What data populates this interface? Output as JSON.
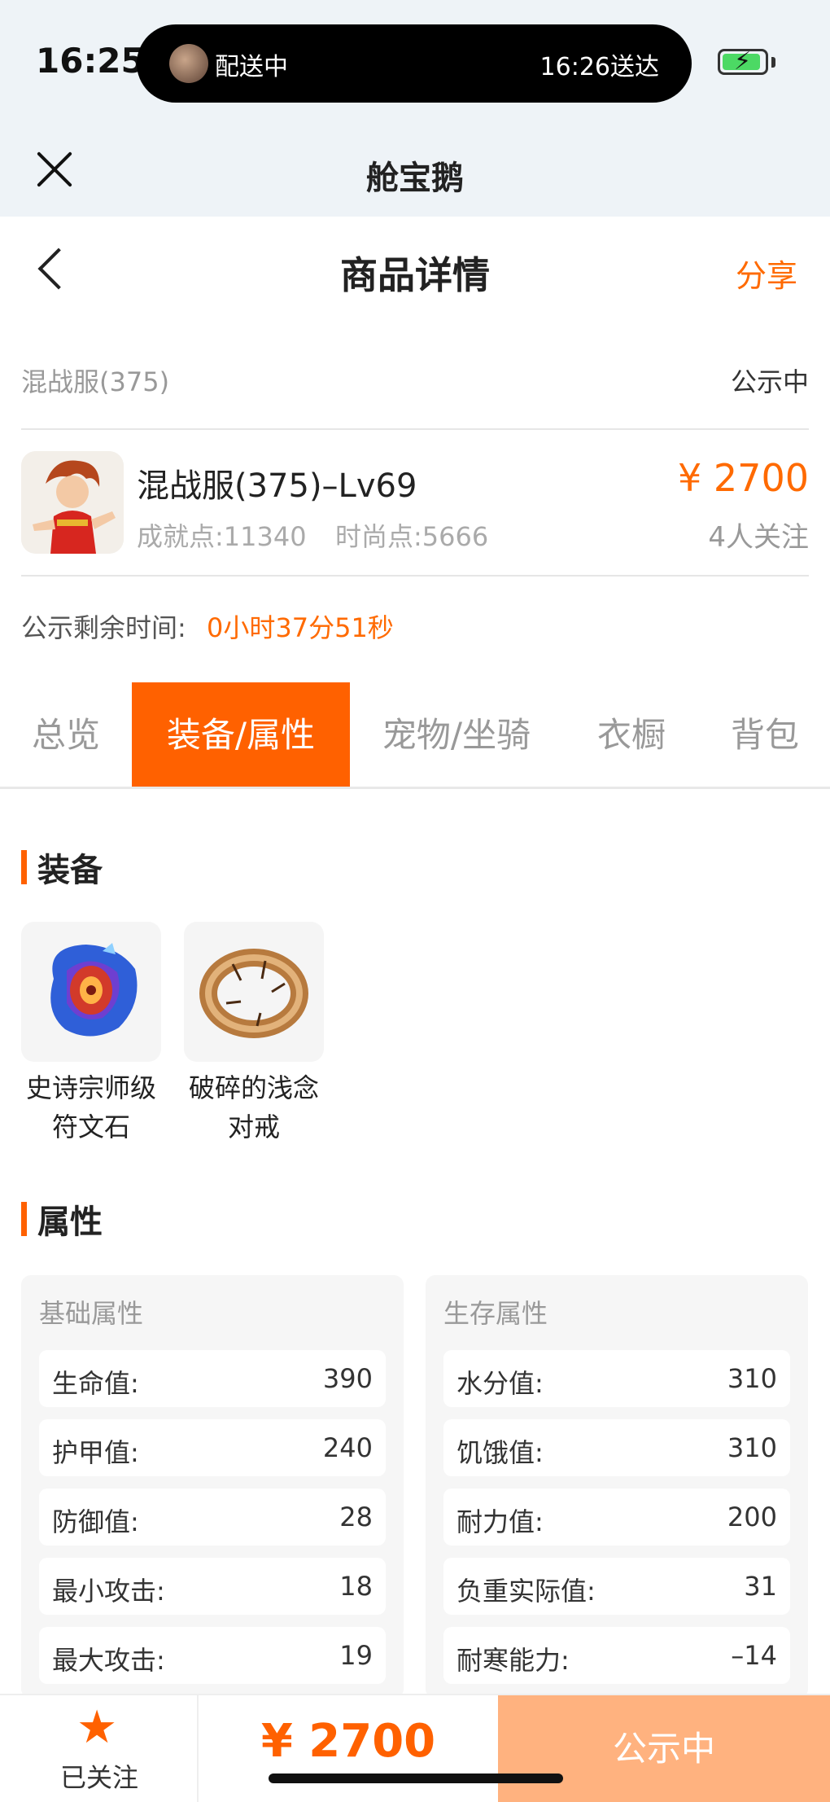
{
  "status_bar": {
    "time": "16:25",
    "island_left": "配送中",
    "island_right": "16:26送达"
  },
  "miniapp": {
    "title": "舱宝鹅"
  },
  "nav": {
    "title": "商品详情",
    "share": "分享"
  },
  "listing": {
    "server": "混战服(375)",
    "status": "公示中",
    "name": "混战服(375)–Lv69",
    "achievement": "成就点:11340",
    "fashion": "时尚点:5666",
    "price": "¥ 2700",
    "followers": "4人关注",
    "countdown_label": "公示剩余时间:",
    "countdown_value": "0小时37分51秒"
  },
  "tabs": [
    {
      "label": "总览",
      "active": false
    },
    {
      "label": "装备/属性",
      "active": true
    },
    {
      "label": "宠物/坐骑",
      "active": false
    },
    {
      "label": "衣橱",
      "active": false
    },
    {
      "label": "背包",
      "active": false
    }
  ],
  "equipment": {
    "title": "装备",
    "items": [
      {
        "line1": "史诗宗师级",
        "line2": "符文石"
      },
      {
        "line1": "破碎的浅念",
        "line2": "对戒"
      }
    ]
  },
  "attributes": {
    "title": "属性",
    "basic": {
      "heading": "基础属性",
      "rows": [
        {
          "k": "生命值:",
          "v": "390"
        },
        {
          "k": "护甲值:",
          "v": "240"
        },
        {
          "k": "防御值:",
          "v": "28"
        },
        {
          "k": "最小攻击:",
          "v": "18"
        },
        {
          "k": "最大攻击:",
          "v": "19"
        }
      ]
    },
    "survival": {
      "heading": "生存属性",
      "rows": [
        {
          "k": "水分值:",
          "v": "310"
        },
        {
          "k": "饥饿值:",
          "v": "310"
        },
        {
          "k": "耐力值:",
          "v": "200"
        },
        {
          "k": "负重实际值:",
          "v": "31"
        },
        {
          "k": "耐寒能力:",
          "v": "–14"
        }
      ]
    }
  },
  "bottom": {
    "follow_label": "已关注",
    "price": "¥ 2700",
    "status": "公示中"
  },
  "colors": {
    "accent": "#ff6100",
    "accent_light": "#ffb27f"
  }
}
